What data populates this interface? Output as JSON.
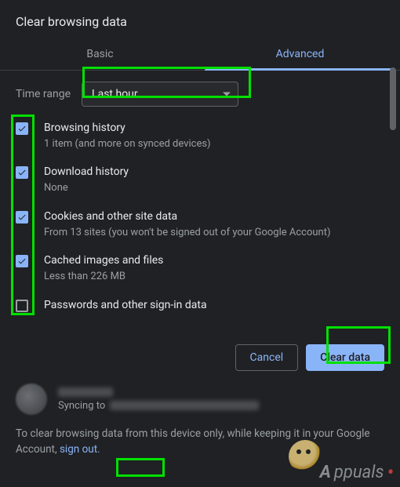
{
  "title": "Clear browsing data",
  "tabs": {
    "basic": "Basic",
    "advanced": "Advanced"
  },
  "range": {
    "label": "Time range",
    "value": "Last hour"
  },
  "items": [
    {
      "title": "Browsing history",
      "sub": "1 item (and more on synced devices)",
      "checked": true
    },
    {
      "title": "Download history",
      "sub": "None",
      "checked": true
    },
    {
      "title": "Cookies and other site data",
      "sub": "From 13 sites (you won't be signed out of your Google Account)",
      "checked": true
    },
    {
      "title": "Cached images and files",
      "sub": "Less than 226 MB",
      "checked": true
    },
    {
      "title": "Passwords and other sign-in data",
      "sub": "",
      "checked": false
    }
  ],
  "buttons": {
    "cancel": "Cancel",
    "clear": "Clear data"
  },
  "footer": {
    "syncing": "Syncing to",
    "text_a": "To clear browsing data from this device only, while keeping it in your Google Account, ",
    "link": "sign out",
    "text_b": "."
  },
  "watermark": "ppuals"
}
